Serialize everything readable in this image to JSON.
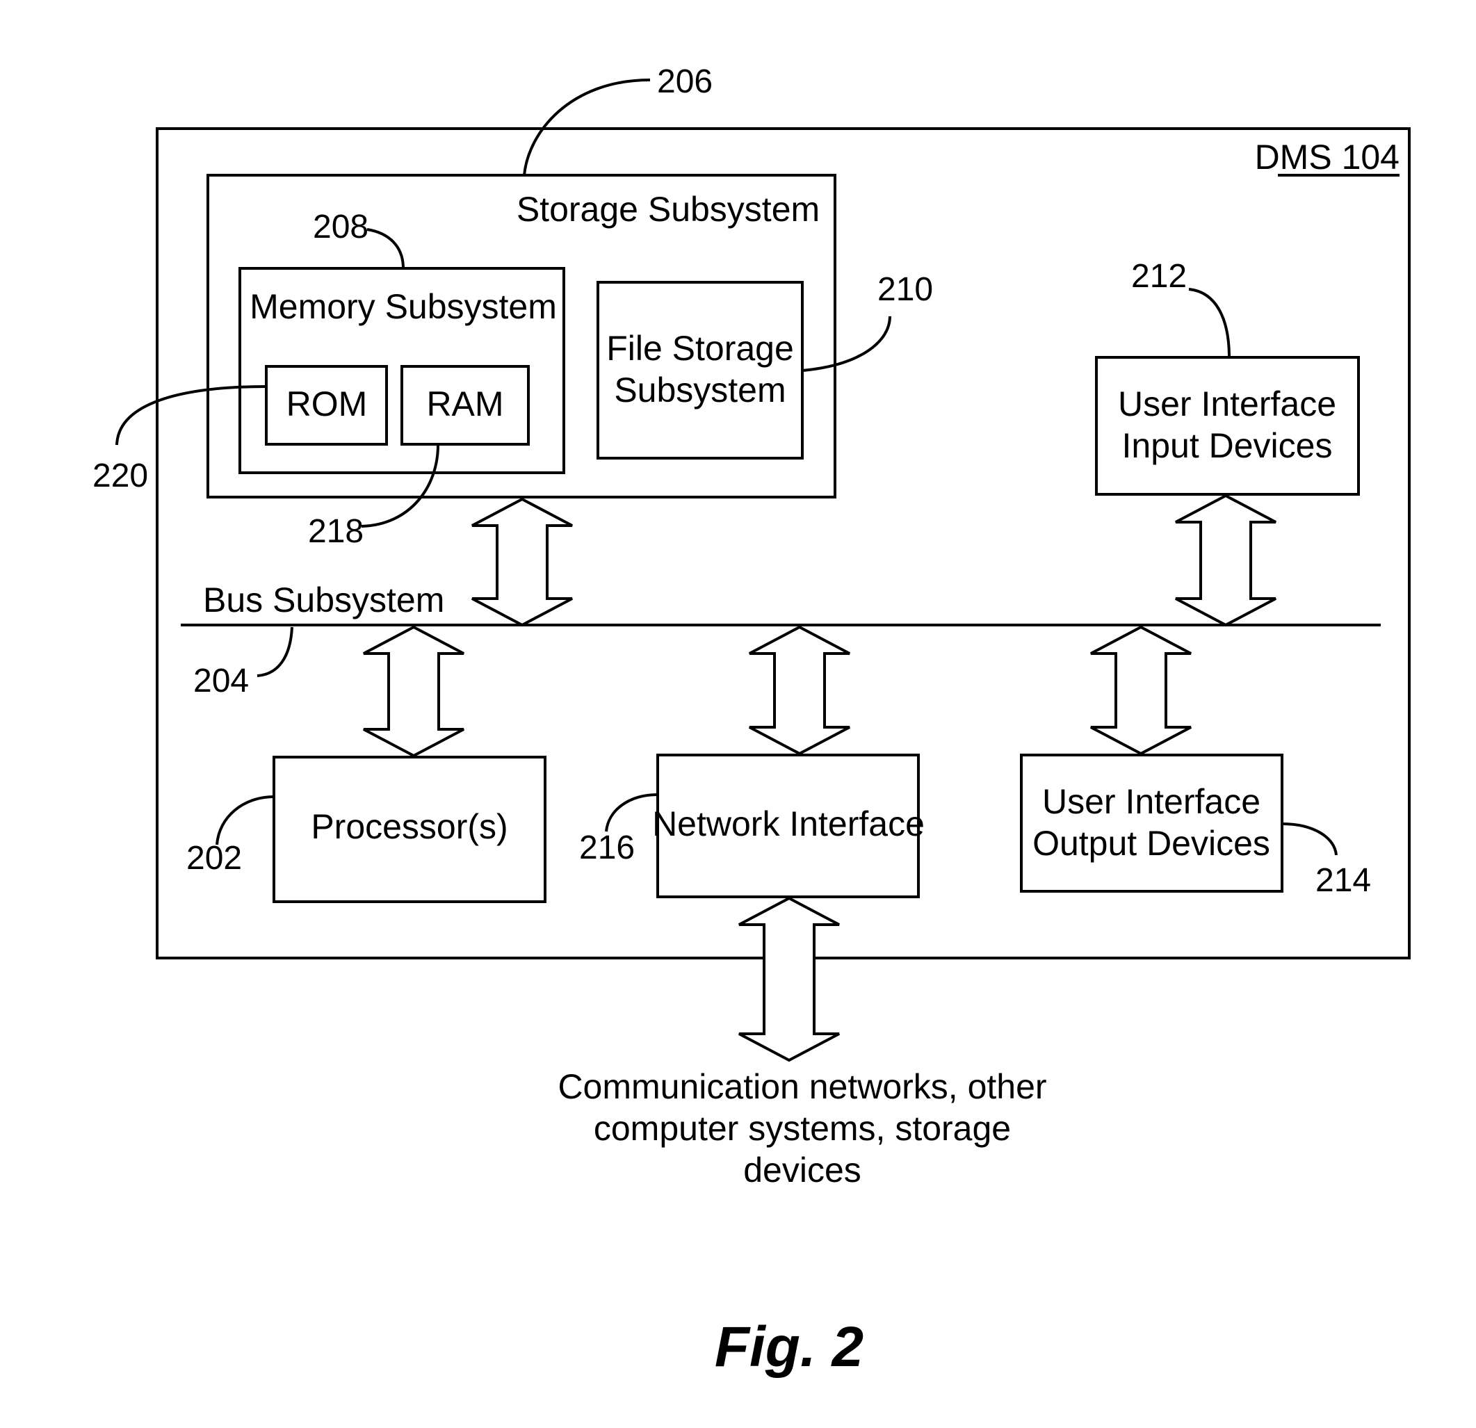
{
  "figure": {
    "caption": "Fig. 2",
    "system_label": "DMS 104"
  },
  "components": {
    "storage_subsystem": {
      "label": "Storage Subsystem",
      "ref": "206"
    },
    "memory_subsystem": {
      "label": "Memory Subsystem",
      "ref": "208"
    },
    "rom": {
      "label": "ROM",
      "ref": "220"
    },
    "ram": {
      "label": "RAM",
      "ref": "218"
    },
    "file_storage": {
      "label_lines": [
        "File Storage",
        "Subsystem"
      ],
      "ref": "210"
    },
    "ui_input": {
      "label_lines": [
        "User Interface",
        "Input Devices"
      ],
      "ref": "212"
    },
    "bus": {
      "label": "Bus Subsystem",
      "ref": "204"
    },
    "processor": {
      "label": "Processor(s)",
      "ref": "202"
    },
    "network_interface": {
      "label": "Network Interface",
      "ref": "216"
    },
    "ui_output": {
      "label_lines": [
        "User Interface",
        "Output Devices"
      ],
      "ref": "214"
    }
  },
  "external": {
    "label_lines": [
      "Communication networks, other",
      "computer systems, storage",
      "devices"
    ]
  }
}
